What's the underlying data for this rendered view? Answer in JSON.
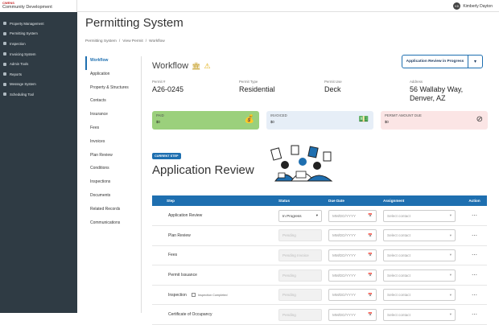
{
  "brand": {
    "top": "CWENS",
    "name": "Community Development"
  },
  "sidebar": {
    "items": [
      {
        "label": "Property Management",
        "icon": "building-icon"
      },
      {
        "label": "Permitting System",
        "icon": "document-icon"
      },
      {
        "label": "Inspection",
        "icon": "clipboard-icon"
      },
      {
        "label": "Invoicing System",
        "icon": "invoice-icon"
      },
      {
        "label": "Admin Tools",
        "icon": "wrench-icon"
      },
      {
        "label": "Reports",
        "icon": "chart-icon"
      },
      {
        "label": "Messsge System",
        "icon": "message-icon"
      },
      {
        "label": "Scheduling Tool",
        "icon": "calendar-icon"
      }
    ]
  },
  "user": {
    "initials": "KD",
    "name": "Kimberly Dayton"
  },
  "page": {
    "title": "Permitting System"
  },
  "breadcrumb": [
    "Permitting System",
    "/",
    "View Permit",
    "/",
    "Workflow"
  ],
  "subnav": [
    "Workflow",
    "Application",
    "Property & Structures",
    "Contacts",
    "Insurance",
    "Fees",
    "Invoices",
    "Plan Review",
    "Conditions",
    "Inspections",
    "Documents",
    "Related Records",
    "Communications"
  ],
  "workflow": {
    "heading": "Workflow",
    "action_label": "Application Review in Progress"
  },
  "fields": [
    {
      "label": "Permit #",
      "value": "A26-0245"
    },
    {
      "label": "Permit Type",
      "value": "Residential"
    },
    {
      "label": "Permit Use",
      "value": "Deck"
    },
    {
      "label": "Address",
      "value": "56 Wallaby Way, Denver, AZ"
    }
  ],
  "cards": [
    {
      "label": "PAID",
      "value": "$0",
      "icon": "money-bag-icon"
    },
    {
      "label": "INVOICED",
      "value": "$0",
      "icon": "invoice-stack-icon"
    },
    {
      "label": "PERMIT AMOUNT DUE",
      "value": "$0",
      "icon": "no-money-icon"
    }
  ],
  "current": {
    "badge": "CURRENT STEP",
    "title": "Application Review"
  },
  "table": {
    "headers": [
      "Step",
      "Status",
      "Due Date",
      "Assignment",
      "Action"
    ],
    "rows": [
      {
        "step": "Application Review",
        "status": "In Progress",
        "due": "MM/DD/YYYY",
        "assign": "Select contact"
      },
      {
        "step": "Plan Review",
        "status": "Pending",
        "due": "MM/DD/YYYY",
        "assign": "Select contact"
      },
      {
        "step": "Fees",
        "status": "Pending Invoice",
        "due": "MM/DD/YYYY",
        "assign": "Select contact"
      },
      {
        "step": "Permit Issuance",
        "status": "Pending",
        "due": "MM/DD/YYYY",
        "assign": "Select contact"
      },
      {
        "step": "Inspection",
        "status": "Pending",
        "due": "MM/DD/YYYY",
        "assign": "Select contact",
        "extra": "Inspection Completed"
      },
      {
        "step": "Certificate of Occupancy",
        "status": "Pending",
        "due": "MM/DD/YYYY",
        "assign": "Select contact"
      }
    ]
  }
}
